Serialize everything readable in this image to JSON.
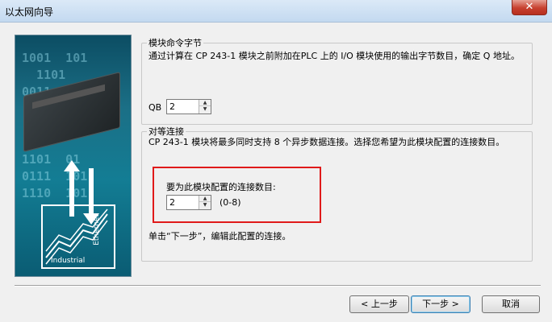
{
  "window": {
    "title": "以太网向导",
    "close_glyph": "✕"
  },
  "section_module_command": {
    "legend": "模块命令字节",
    "description": "通过计算在 CP 243-1  模块之前附加在PLC 上的 I/O 模块使用的输出字节数目，确定 Q 地址。",
    "qb_label": "QB",
    "qb_value": "2"
  },
  "section_peer": {
    "legend": "对等连接",
    "description": "CP 243-1  模块将最多同时支持 8 个异步数据连接。选择您希望为此模块配置的连接数目。",
    "connections_label": "要为此模块配置的连接数目:",
    "connections_value": "2",
    "range_hint": "(0-8)",
    "next_hint": "单击“下一步”，编辑此配置的连接。"
  },
  "side_image": {
    "binary_lines": [
      "1001  101",
      "  1101",
      "0011",
      "",
      "",
      "",
      "1101  01",
      "0111  101",
      "1110  101"
    ],
    "brand_word": "Industrial",
    "eth_word": "Ethernet"
  },
  "buttons": {
    "back": "< 上一步",
    "next": "下一步 >",
    "cancel": "取消"
  },
  "spin_glyphs": {
    "up": "▲",
    "down": "▼"
  },
  "colors": {
    "highlight": "#e01a1a",
    "titlebar": "#dbe9f7"
  }
}
